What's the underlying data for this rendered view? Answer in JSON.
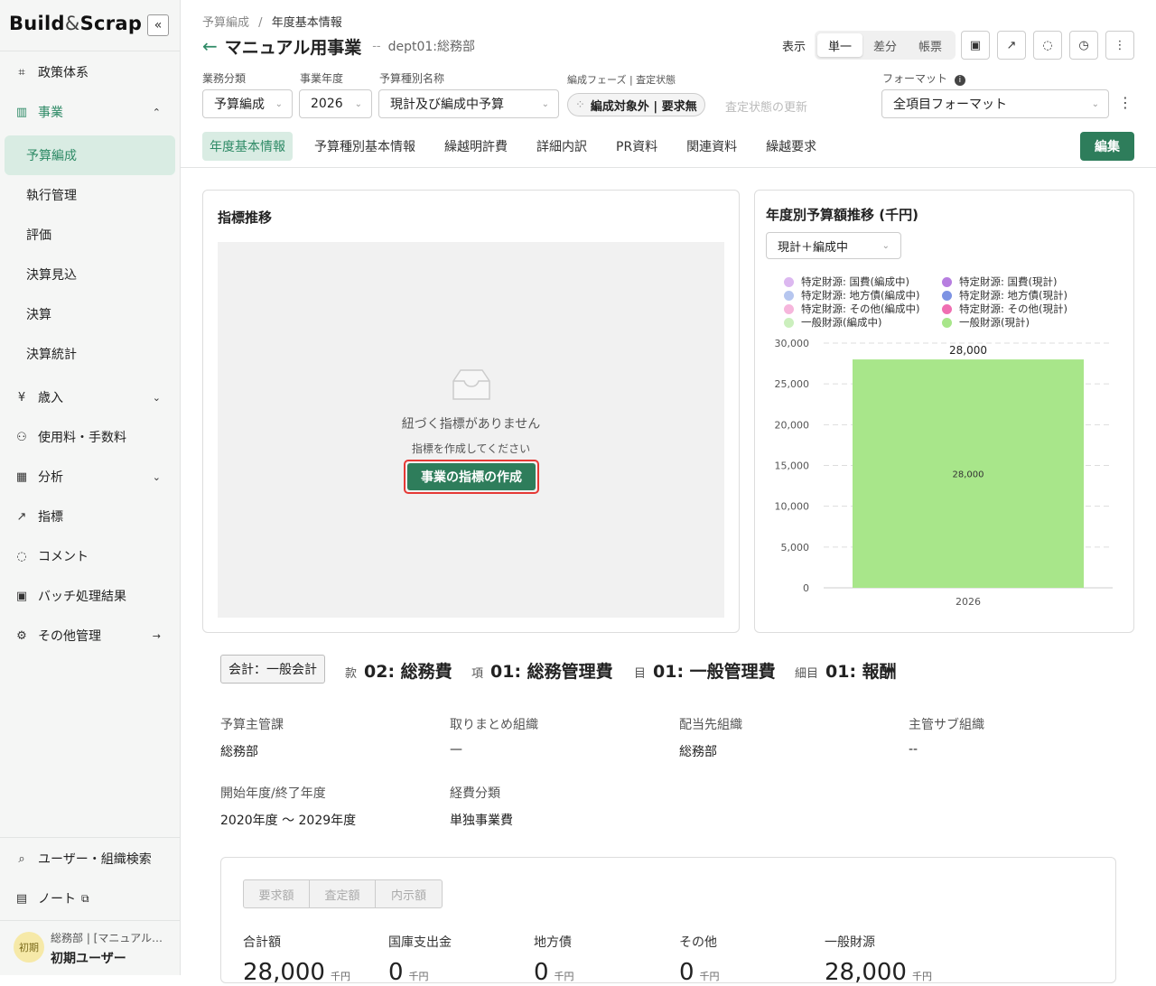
{
  "sidebar": {
    "logo_a": "Build",
    "logo_amp": "&",
    "logo_b": "Scrap",
    "collapse": "«",
    "items": {
      "seisaku": {
        "icon": "⌗",
        "label": "政策体系"
      },
      "jigyo": {
        "icon": "▥",
        "label": "事業"
      },
      "sainyu": {
        "icon": "¥",
        "label": "歳入"
      },
      "shiyoryo": {
        "icon": "⚇",
        "label": "使用料・手数料"
      },
      "bunseki": {
        "icon": "▦",
        "label": "分析"
      },
      "shihyo": {
        "icon": "↗",
        "label": "指標"
      },
      "comment": {
        "icon": "◌",
        "label": "コメント"
      },
      "batch": {
        "icon": "▣",
        "label": "バッチ処理結果"
      },
      "sonota": {
        "icon": "⚙",
        "label": "その他管理"
      },
      "search": {
        "icon": "⌕",
        "label": "ユーザー・組織検索"
      },
      "note": {
        "icon": "▤",
        "label": "ノート"
      }
    },
    "sub_items": [
      "予算編成",
      "執行管理",
      "評価",
      "決算見込",
      "決算",
      "決算統計"
    ],
    "chevron_up": "⌃",
    "chevron_down": "⌄",
    "arrow_right": "→",
    "external_icon": "⧉",
    "user": {
      "avatar": "初期",
      "org": "総務部 | [マニュアル…",
      "name": "初期ユーザー"
    }
  },
  "header": {
    "breadcrumb_root": "予算編成",
    "breadcrumb_sep": "/",
    "breadcrumb_current": "年度基本情報",
    "back": "←",
    "title": "マニュアル用事業",
    "dash": "--",
    "dept": "dept01:総務部",
    "view_label": "表示",
    "view_options": [
      "単一",
      "差分",
      "帳票"
    ],
    "icons": {
      "calendar": "▣",
      "trend": "↗",
      "chat": "◌",
      "history": "◷",
      "more": "⋮"
    }
  },
  "filters": {
    "business_label": "業務分類",
    "business_value": "予算編成",
    "year_label": "事業年度",
    "year_value": "2026",
    "type_label": "予算種別名称",
    "type_value": "現計及び編成中予算",
    "phase_label": "編成フェーズ | 査定状態",
    "phase_value": "編成対象外 | 要求無",
    "phase_icon": "⁘",
    "update_link": "査定状態の更新",
    "format_label": "フォーマット",
    "format_info": "i",
    "format_value": "全項目フォーマット",
    "more": "⋮",
    "dropdown": "⌄"
  },
  "tabs": [
    "年度基本情報",
    "予算種別基本情報",
    "繰越明許費",
    "詳細内訳",
    "PR資料",
    "関連資料",
    "繰越要求"
  ],
  "edit_button": "編集",
  "indicator_card": {
    "title": "指標推移",
    "empty_message": "紐づく指標がありません",
    "empty_sub": "指標を作成してください",
    "create_button": "事業の指標の作成"
  },
  "budget_card": {
    "title": "年度別予算額推移 (千円)",
    "select_value": "現計＋編成中"
  },
  "chart_data": {
    "type": "bar",
    "title": "年度別予算額推移 (千円)",
    "categories": [
      "2026"
    ],
    "stacked": true,
    "series": [
      {
        "name": "特定財源: 国費(編成中)",
        "color": "#dcb8f0",
        "values": [
          0
        ]
      },
      {
        "name": "特定財源: 国費(現計)",
        "color": "#b77ee0",
        "values": [
          0
        ]
      },
      {
        "name": "特定財源: 地方債(編成中)",
        "color": "#b6c6ef",
        "values": [
          0
        ]
      },
      {
        "name": "特定財源: 地方債(現計)",
        "color": "#7d93e3",
        "values": [
          0
        ]
      },
      {
        "name": "特定財源: その他(編成中)",
        "color": "#f6b6dc",
        "values": [
          0
        ]
      },
      {
        "name": "特定財源: その他(現計)",
        "color": "#ef6fb2",
        "values": [
          0
        ]
      },
      {
        "name": "一般財源(編成中)",
        "color": "#cbefbd",
        "values": [
          0
        ]
      },
      {
        "name": "一般財源(現計)",
        "color": "#a8e68a",
        "values": [
          28000
        ]
      }
    ],
    "total_labels": [
      "28,000"
    ],
    "inner_labels": [
      "28,000"
    ],
    "y_ticks": [
      "0",
      "5,000",
      "10,000",
      "15,000",
      "20,000",
      "25,000",
      "30,000"
    ],
    "ylim": [
      0,
      30000
    ],
    "grid": true,
    "legend_position": "top"
  },
  "account": {
    "kaikei": "会計：一般会計",
    "kan_label": "款",
    "kan_value": "02: 総務費",
    "ko_label": "項",
    "ko_value": "01: 総務管理費",
    "moku_label": "目",
    "moku_value": "01: 一般管理費",
    "saimoku_label": "細目",
    "saimoku_value": "01: 報酬"
  },
  "details": {
    "r1": [
      {
        "label": "予算主管課",
        "value": "総務部"
      },
      {
        "label": "取りまとめ組織",
        "value": "—"
      },
      {
        "label": "配当先組織",
        "value": "総務部"
      },
      {
        "label": "主管サブ組織",
        "value": "--"
      }
    ],
    "r2": [
      {
        "label": "開始年度/終了年度",
        "value": "2020年度 〜 2029年度"
      },
      {
        "label": "経費分類",
        "value": "単独事業費"
      }
    ]
  },
  "amounts": {
    "tabs": [
      "要求額",
      "査定額",
      "内示額"
    ],
    "unit": "千円",
    "items": [
      {
        "label": "合計額",
        "value": "28,000"
      },
      {
        "label": "国庫支出金",
        "value": "0"
      },
      {
        "label": "地方債",
        "value": "0"
      },
      {
        "label": "その他",
        "value": "0"
      },
      {
        "label": "一般財源",
        "value": "28,000"
      }
    ]
  }
}
